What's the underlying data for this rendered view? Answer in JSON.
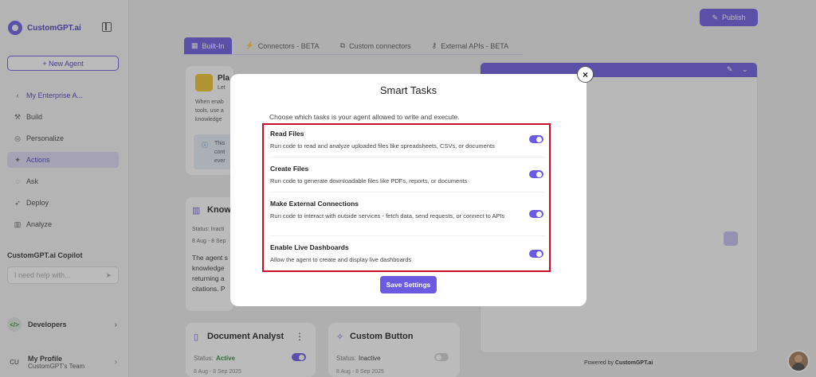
{
  "sidebar": {
    "brand": "CustomGPT.ai",
    "new_agent": "+ New Agent",
    "agent_back": "My Enterprise A...",
    "items": [
      {
        "label": "Build",
        "icon": "build-icon"
      },
      {
        "label": "Personalize",
        "icon": "palette-icon"
      },
      {
        "label": "Actions",
        "icon": "actions-icon",
        "active": true
      },
      {
        "label": "Ask",
        "icon": "chat-icon"
      },
      {
        "label": "Deploy",
        "icon": "rocket-icon"
      },
      {
        "label": "Analyze",
        "icon": "chart-icon"
      }
    ],
    "copilot_title": "CustomGPT.ai Copilot",
    "copilot_placeholder": "I need help with...",
    "developers": "Developers",
    "developers_icon": "</>",
    "profile_initials": "CU",
    "profile_name": "My Profile",
    "profile_team": "CustomGPT's Team"
  },
  "header": {
    "publish": "Publish"
  },
  "tabs": [
    {
      "label": "Built-In",
      "active": true
    },
    {
      "label": "Connectors - BETA"
    },
    {
      "label": "Custom connectors"
    },
    {
      "label": "External APIs - BETA"
    }
  ],
  "cards": {
    "a": {
      "title": "Pla",
      "sub": "Let",
      "desc_lines": [
        "When enab",
        "tools, use a",
        "knowledge"
      ],
      "info_lines": [
        "This",
        "cont",
        "ever"
      ]
    },
    "b": {
      "title": "Know",
      "status": "Status: Inacti",
      "dates": "8 Aug - 8 Sep",
      "desc_lines": [
        "The agent s",
        "knowledge",
        "returning a",
        "citations. P"
      ]
    },
    "c": {
      "title": "Document Analyst",
      "status_label": "Status:",
      "status_value": "Active",
      "dates": "8 Aug - 8 Sep 2025",
      "enabled": true
    },
    "d": {
      "title": "Custom Button",
      "status_label": "Status:",
      "status_value": "Inactive",
      "dates": "8 Aug - 8 Sep 2025",
      "enabled": false
    }
  },
  "preview": {
    "powered_prefix": "Powered by",
    "powered_brand": "CustomGPT.ai"
  },
  "modal": {
    "title": "Smart Tasks",
    "subtitle": "Choose which tasks is your agent allowed to write and execute.",
    "close": "×",
    "tasks": [
      {
        "name": "Read Files",
        "desc": "Run code to read and analyze uploaded files like spreadsheets, CSVs, or documents",
        "enabled": true
      },
      {
        "name": "Create Files",
        "desc": "Run code to generate downloadable files like PDFs, reports, or documents",
        "enabled": true
      },
      {
        "name": "Make External Connections",
        "desc": "Run code to interact with outside services - fetch data, send requests, or connect to APIs",
        "enabled": true
      },
      {
        "name": "Enable Live Dashboards",
        "desc": "Allow the agent to create and display live dashboards",
        "enabled": true
      }
    ],
    "save": "Save Settings"
  },
  "colors": {
    "accent": "#6b5be0",
    "highlight_border": "#c8102e",
    "active_status": "#2d8a3e"
  }
}
